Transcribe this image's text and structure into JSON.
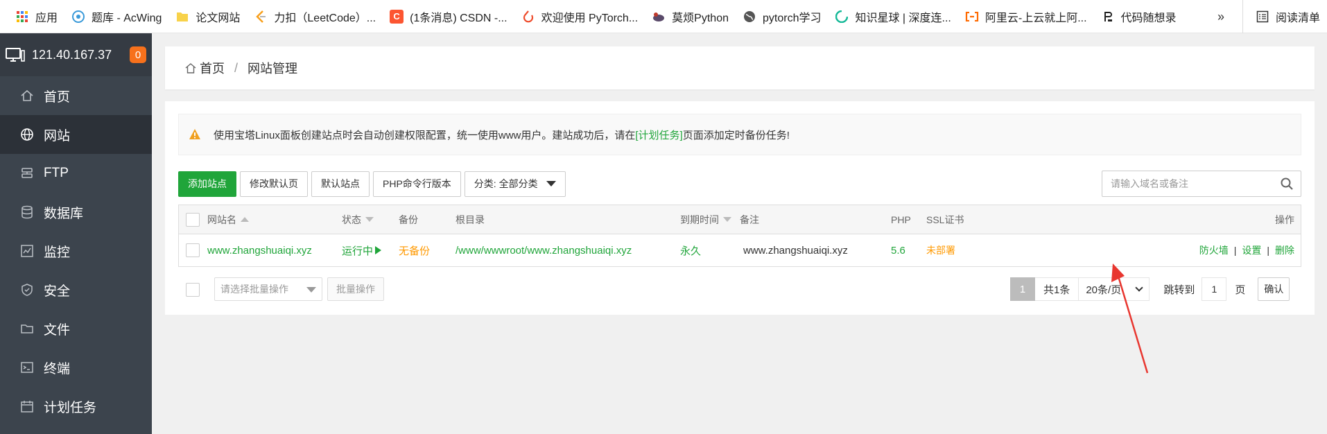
{
  "bookmarks": [
    {
      "label": "应用",
      "icon": "apps-grid-icon"
    },
    {
      "label": "题库 - AcWing",
      "icon": "acwing-icon"
    },
    {
      "label": "论文网站",
      "icon": "folder-icon"
    },
    {
      "label": "力扣（LeetCode）...",
      "icon": "leetcode-icon"
    },
    {
      "label": "(1条消息) CSDN -...",
      "icon": "csdn-icon"
    },
    {
      "label": "欢迎使用 PyTorch...",
      "icon": "pytorch-icon"
    },
    {
      "label": "莫烦Python",
      "icon": "mofan-icon"
    },
    {
      "label": "pytorch学习",
      "icon": "globe-icon"
    },
    {
      "label": "知识星球 | 深度连...",
      "icon": "zsxq-icon"
    },
    {
      "label": "阿里云-上云就上阿...",
      "icon": "aliyun-icon"
    },
    {
      "label": "代码随想录",
      "icon": "code-icon"
    }
  ],
  "bookmarks_more": "»",
  "reading_list": "阅读清单",
  "server": {
    "ip": "121.40.167.37",
    "badge": "0"
  },
  "nav": [
    {
      "label": "首页",
      "icon": "home-icon"
    },
    {
      "label": "网站",
      "icon": "globe-icon",
      "active": true
    },
    {
      "label": "FTP",
      "icon": "ftp-icon"
    },
    {
      "label": "数据库",
      "icon": "database-icon"
    },
    {
      "label": "监控",
      "icon": "monitor-icon"
    },
    {
      "label": "安全",
      "icon": "shield-icon"
    },
    {
      "label": "文件",
      "icon": "folder-icon"
    },
    {
      "label": "终端",
      "icon": "terminal-icon"
    },
    {
      "label": "计划任务",
      "icon": "calendar-icon"
    }
  ],
  "breadcrumb": {
    "home": "首页",
    "sep": "/",
    "current": "网站管理"
  },
  "notice": {
    "text_before": "使用宝塔Linux面板创建站点时会自动创建权限配置，统一使用www用户。建站成功后，请在",
    "link": "[计划任务]",
    "text_after": "页面添加定时备份任务!"
  },
  "toolbar": {
    "add_site": "添加站点",
    "edit_default": "修改默认页",
    "default_site": "默认站点",
    "php_cli": "PHP命令行版本",
    "category": "分类: 全部分类"
  },
  "search": {
    "placeholder": "请输入域名或备注"
  },
  "table": {
    "headers": {
      "name": "网站名",
      "status": "状态",
      "backup": "备份",
      "root": "根目录",
      "expire": "到期时间",
      "remark": "备注",
      "php": "PHP",
      "ssl": "SSL证书",
      "ops": "操作"
    },
    "rows": [
      {
        "name": "www.zhangshuaiqi.xyz",
        "status": "运行中",
        "backup": "无备份",
        "root": "/www/wwwroot/www.zhangshuaiqi.xyz",
        "expire": "永久",
        "remark": "www.zhangshuaiqi.xyz",
        "php": "5.6",
        "ssl": "未部署",
        "ops": {
          "firewall": "防火墙",
          "settings": "设置",
          "delete": "删除",
          "sep": "|"
        }
      }
    ]
  },
  "footer": {
    "batch_placeholder": "请选择批量操作",
    "batch_button": "批量操作",
    "page": "1",
    "total": "共1条",
    "page_size": "20条/页",
    "jump_label": "跳转到",
    "jump_value": "1",
    "page_unit": "页",
    "confirm": "确认"
  },
  "colors": {
    "accent": "#20a53a",
    "warning": "#ff9900",
    "sidebar": "#3c444d",
    "annotation_arrow": "#e8362f"
  }
}
